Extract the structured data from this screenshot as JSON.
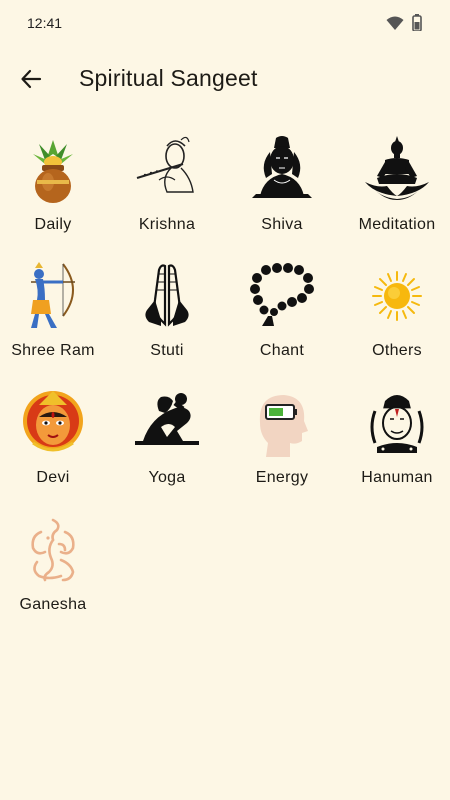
{
  "status_bar": {
    "time": "12:41",
    "icons": [
      "wifi-icon",
      "battery-icon"
    ]
  },
  "app_bar": {
    "title": "Spiritual Sangeet",
    "back_icon": "arrow-left-icon"
  },
  "categories": [
    {
      "label": "Daily",
      "icon": "kalash-icon"
    },
    {
      "label": "Krishna",
      "icon": "krishna-flute-icon"
    },
    {
      "label": "Shiva",
      "icon": "shiva-icon"
    },
    {
      "label": "Meditation",
      "icon": "meditation-lotus-icon"
    },
    {
      "label": "Shree Ram",
      "icon": "ram-archer-icon"
    },
    {
      "label": "Stuti",
      "icon": "praying-hands-icon"
    },
    {
      "label": "Chant",
      "icon": "rosary-beads-icon"
    },
    {
      "label": "Others",
      "icon": "sun-icon"
    },
    {
      "label": "Devi",
      "icon": "devi-face-icon"
    },
    {
      "label": "Yoga",
      "icon": "yoga-pose-icon"
    },
    {
      "label": "Energy",
      "icon": "head-battery-icon"
    },
    {
      "label": "Hanuman",
      "icon": "hanuman-icon"
    },
    {
      "label": "Ganesha",
      "icon": "ganesha-icon"
    }
  ],
  "colors": {
    "background": "#FDF7E5",
    "text": "#1D1B16"
  }
}
